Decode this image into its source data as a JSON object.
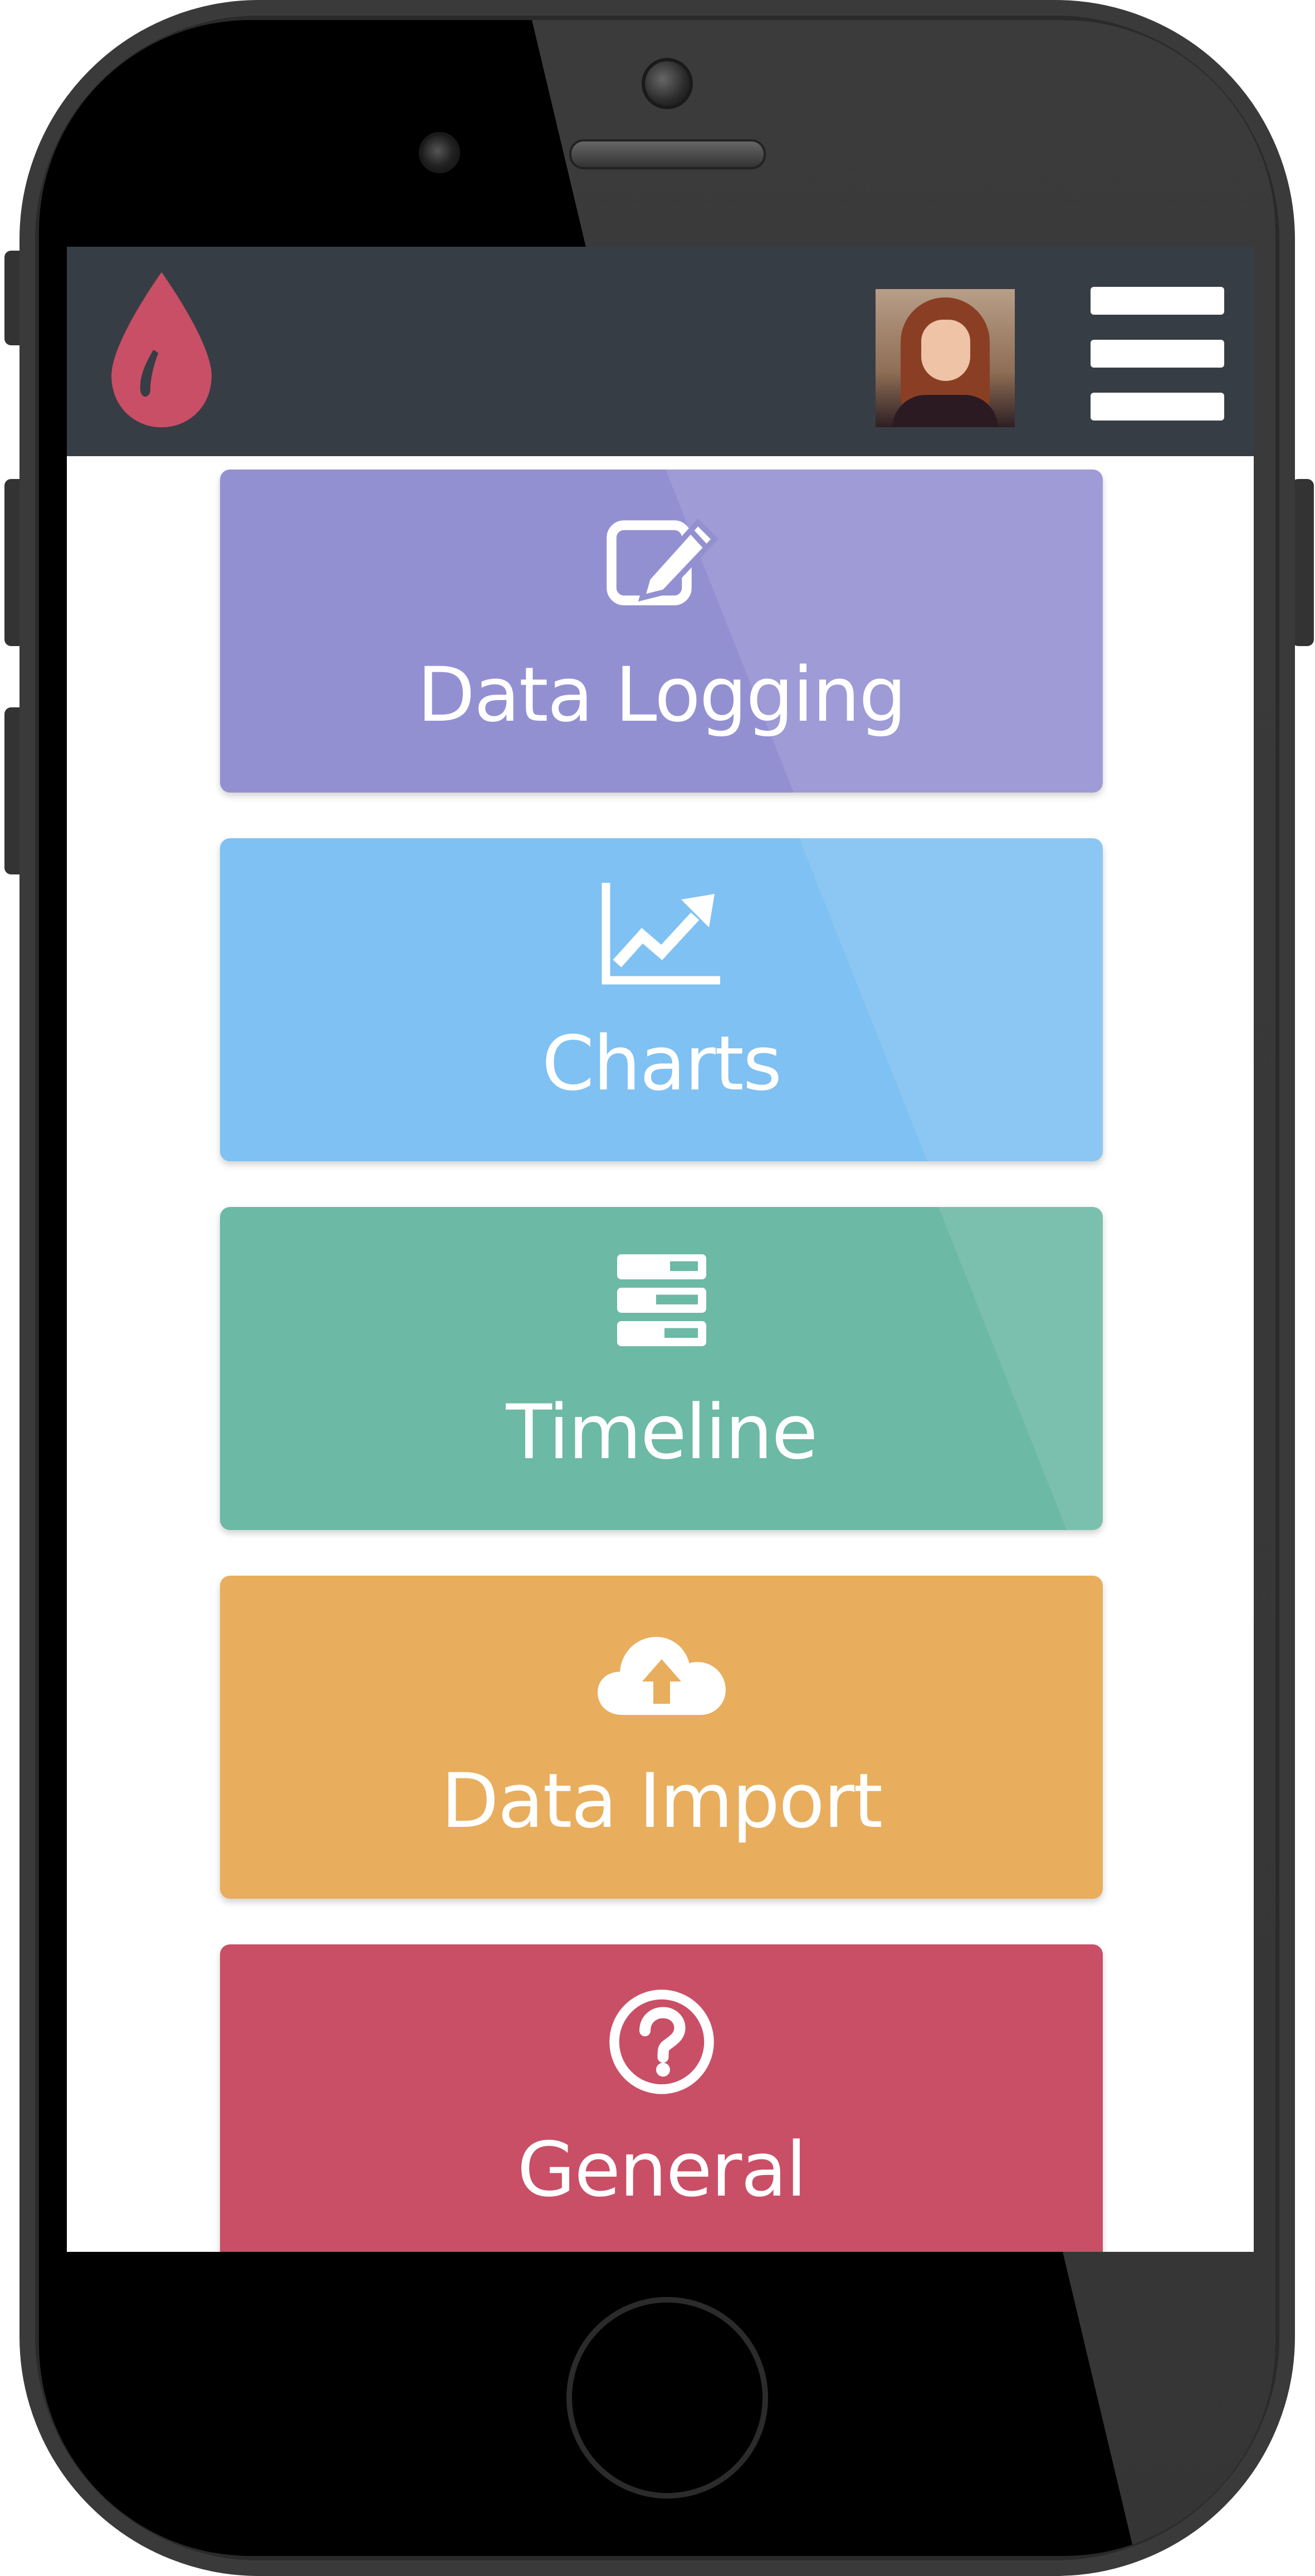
{
  "colors": {
    "header_bg": "#373d45",
    "logo_drop": "#c94f66",
    "tile_data_logging": "#9390d2",
    "tile_charts": "#7fc1f2",
    "tile_timeline": "#6cb9a5",
    "tile_data_import": "#e8ae5d",
    "tile_general": "#c94f66"
  },
  "header": {
    "logo_icon": "blood-drop-icon",
    "avatar_alt": "user avatar",
    "menu_icon": "hamburger-menu-icon"
  },
  "tiles": [
    {
      "label": "Data Logging",
      "icon": "edit-pencil-icon"
    },
    {
      "label": "Charts",
      "icon": "line-chart-icon"
    },
    {
      "label": "Timeline",
      "icon": "timeline-list-icon"
    },
    {
      "label": "Data Import",
      "icon": "cloud-upload-icon"
    },
    {
      "label": "General",
      "icon": "question-circle-icon"
    }
  ]
}
